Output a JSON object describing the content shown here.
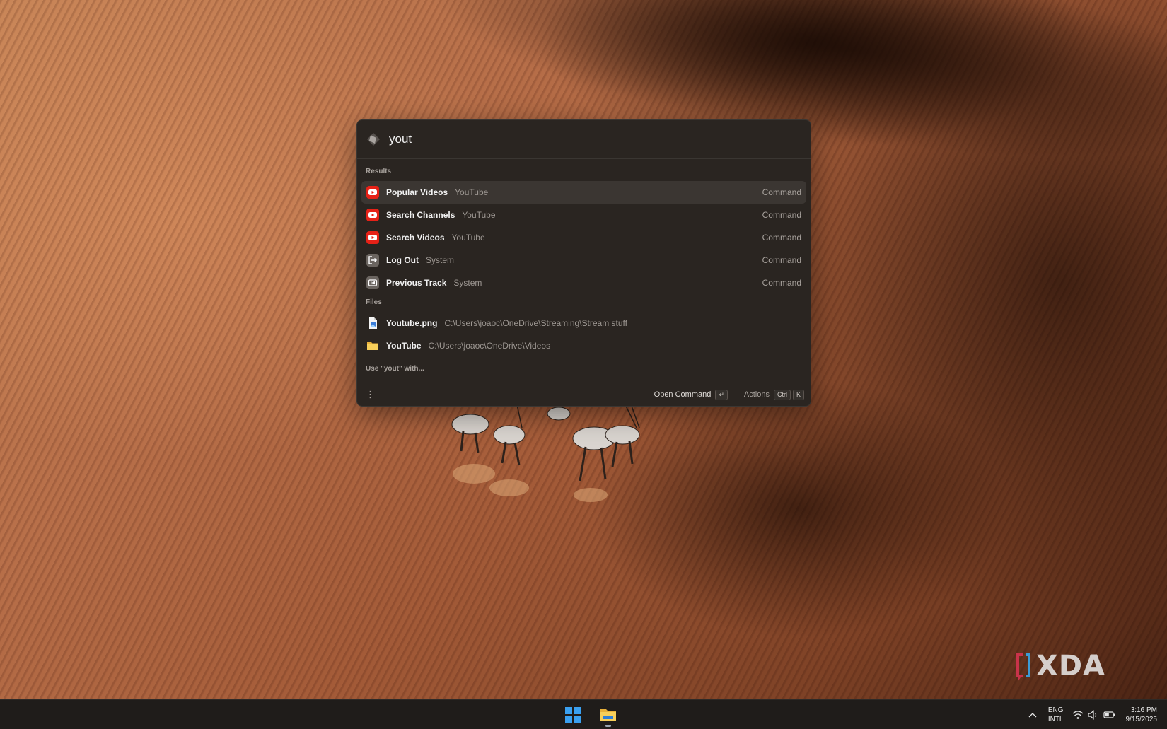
{
  "search": {
    "value": "yout",
    "placeholder": ""
  },
  "sections": {
    "results_label": "Results",
    "files_label": "Files"
  },
  "results": [
    {
      "title": "Popular Videos",
      "subtitle": "YouTube",
      "kind": "Command",
      "icon": "youtube-icon",
      "selected": true
    },
    {
      "title": "Search Channels",
      "subtitle": "YouTube",
      "kind": "Command",
      "icon": "youtube-icon"
    },
    {
      "title": "Search Videos",
      "subtitle": "YouTube",
      "kind": "Command",
      "icon": "youtube-icon"
    },
    {
      "title": "Log Out",
      "subtitle": "System",
      "kind": "Command",
      "icon": "log-out-icon"
    },
    {
      "title": "Previous Track",
      "subtitle": "System",
      "kind": "Command",
      "icon": "previous-track-icon"
    }
  ],
  "files": [
    {
      "title": "Youtube.png",
      "path": "C:\\Users\\joaoc\\OneDrive\\Streaming\\Stream stuff",
      "icon": "image-file-icon"
    },
    {
      "title": "YouTube",
      "path": "C:\\Users\\joaoc\\OneDrive\\Videos",
      "icon": "folder-icon"
    }
  ],
  "use_with": "Use \"yout\" with...",
  "footer": {
    "more_glyph": "⋮",
    "primary_action": "Open Command",
    "primary_key": "↵",
    "actions_label": "Actions",
    "actions_keys": [
      "Ctrl",
      "K"
    ]
  },
  "watermark": {
    "text": "XDA"
  },
  "taskbar": {
    "language_top": "ENG",
    "language_bottom": "INTL",
    "time": "3:16 PM",
    "date": "9/15/2025"
  },
  "colors": {
    "youtube_red": "#e62117",
    "system_icon_bg": "#6b6560",
    "selected_row": "#3b3632",
    "panel_bg": "#2a2521",
    "folder_yellow": "#f1c04a",
    "windows_blue": "#3aa0f0"
  }
}
